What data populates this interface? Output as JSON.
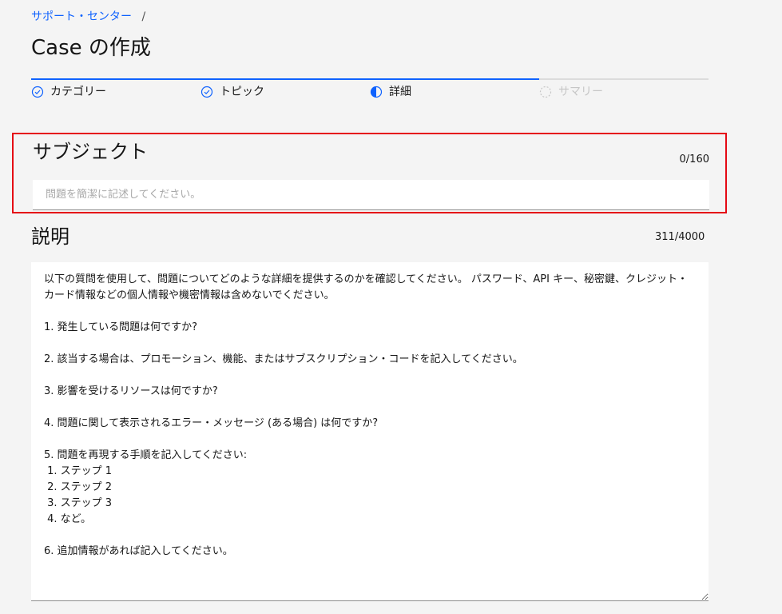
{
  "breadcrumb": {
    "link": "サポート・センター",
    "separator": "/"
  },
  "page": {
    "title": "Case の作成"
  },
  "progress": {
    "steps": [
      {
        "label": "カテゴリー",
        "state": "complete"
      },
      {
        "label": "トピック",
        "state": "complete"
      },
      {
        "label": "詳細",
        "state": "current"
      },
      {
        "label": "サマリー",
        "state": "disabled"
      }
    ],
    "colors": {
      "accent": "#0f62fe",
      "disabled": "#c6c6c6"
    }
  },
  "subject": {
    "heading": "サブジェクト",
    "counter": "0/160",
    "placeholder": "問題を簡潔に記述してください。",
    "value": ""
  },
  "description": {
    "heading": "説明",
    "counter": "311/4000",
    "value": "以下の質問を使用して、問題についてどのような詳細を提供するのかを確認してください。 パスワード、API キー、秘密鍵、クレジット・カード情報などの個人情報や機密情報は含めないでください。\n\n1. 発生している問題は何ですか?\n\n2. 該当する場合は、プロモーション、機能、またはサブスクリプション・コードを記入してください。\n\n3. 影響を受けるリソースは何ですか?\n\n4. 問題に関して表示されるエラー・メッセージ (ある場合) は何ですか?\n\n5. 問題を再現する手順を記入してください:\n 1. ステップ 1\n 2. ステップ 2\n 3. ステップ 3\n 4. など。\n\n6. 追加情報があれば記入してください。"
  },
  "highlight": {
    "color": "#e50914"
  }
}
